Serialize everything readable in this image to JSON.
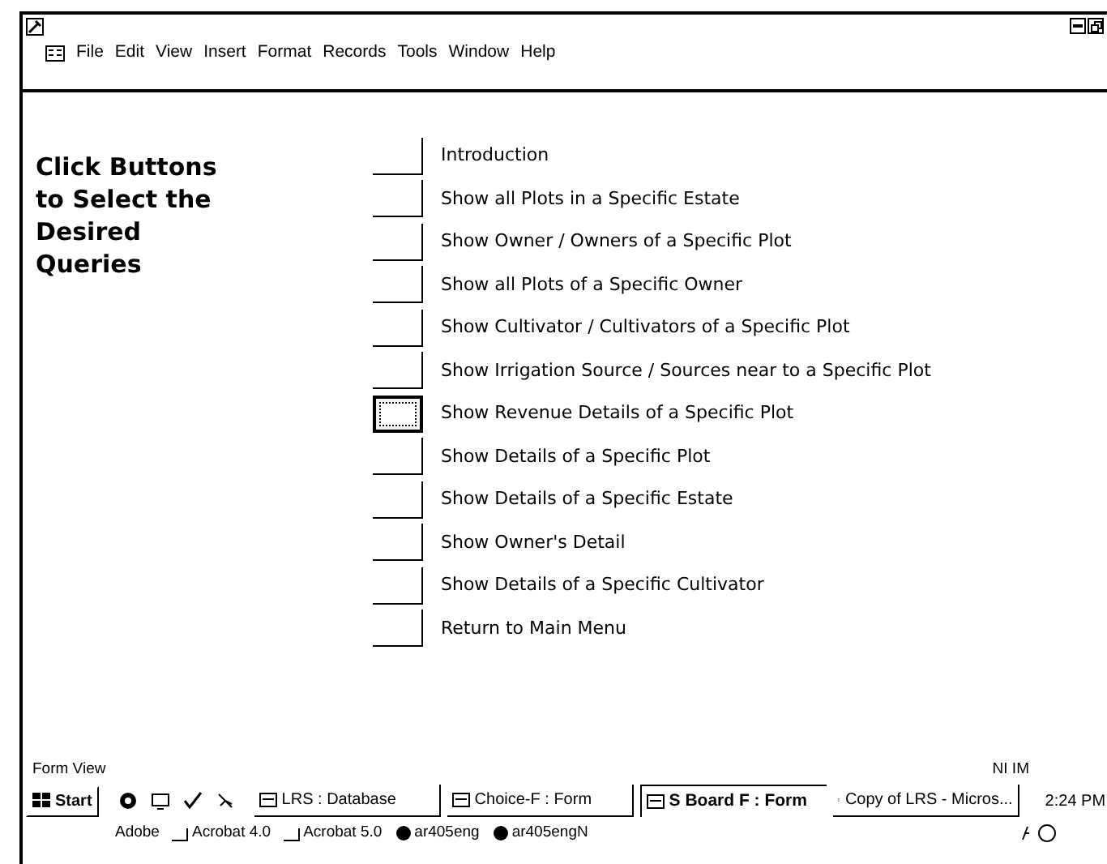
{
  "menu_bar": {
    "items": [
      "File",
      "Edit",
      "View",
      "Insert",
      "Format",
      "Records",
      "Tools",
      "Window",
      "Help"
    ]
  },
  "form": {
    "instructions": [
      "Click Buttons",
      "to Select the",
      "Desired",
      "Queries"
    ],
    "queries": [
      {
        "label": "Introduction",
        "focused": false
      },
      {
        "label": "Show all Plots in a Specific Estate",
        "focused": false
      },
      {
        "label": "Show Owner / Owners of a Specific Plot",
        "focused": false
      },
      {
        "label": "Show all Plots of a Specific Owner",
        "focused": false
      },
      {
        "label": "Show Cultivator / Cultivators of a Specific Plot",
        "focused": false
      },
      {
        "label": "Show Irrigation Source / Sources near to a Specific Plot",
        "focused": false
      },
      {
        "label": "Show Revenue Details of a Specific Plot",
        "focused": true
      },
      {
        "label": "Show Details of a Specific Plot",
        "focused": false
      },
      {
        "label": "Show Details of a Specific Estate",
        "focused": false
      },
      {
        "label": "Show Owner's Detail",
        "focused": false
      },
      {
        "label": "Show Details of a Specific Cultivator",
        "focused": false
      },
      {
        "label": "Return to Main Menu",
        "focused": false
      }
    ]
  },
  "status_bar": {
    "mode": "Form View",
    "indicators": "NI IM"
  },
  "taskbar": {
    "start": "Start",
    "tasks": [
      {
        "label": "LRS : Database",
        "selected": false
      },
      {
        "label": "Choice-F : Form",
        "selected": false
      },
      {
        "label": "S Board F : Form",
        "selected": true
      },
      {
        "label": "Copy of LRS - Micros...",
        "selected": false
      }
    ],
    "clock": "2:24 PM",
    "toolbar": [
      {
        "label": "Adobe",
        "kind": "text"
      },
      {
        "label": "Acrobat 4.0",
        "kind": "folder"
      },
      {
        "label": "Acrobat 5.0",
        "kind": "folder"
      },
      {
        "label": "ar405eng",
        "kind": "app"
      },
      {
        "label": "ar405engN",
        "kind": "app"
      }
    ]
  }
}
